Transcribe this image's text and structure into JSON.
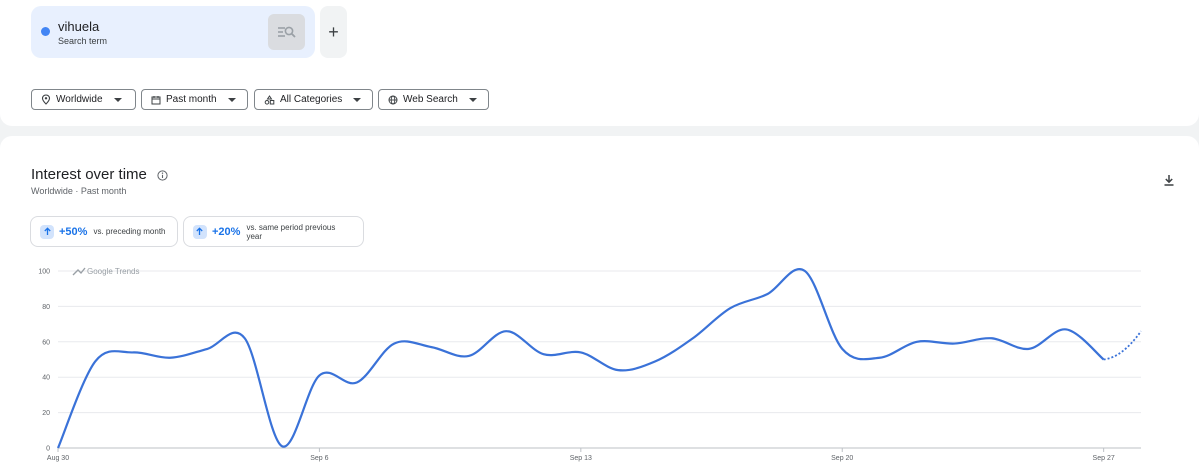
{
  "search_term": {
    "name": "vihuela",
    "subtitle": "Search term",
    "dot_color": "#4285f4",
    "compare_icon": "search-compare-icon",
    "add_icon": "plus-icon"
  },
  "filters": [
    {
      "label": "Worldwide",
      "icon": "location-pin-icon"
    },
    {
      "label": "Past month",
      "icon": "calendar-icon"
    },
    {
      "label": "All Categories",
      "icon": "categories-icon"
    },
    {
      "label": "Web Search",
      "icon": "globe-icon"
    }
  ],
  "section": {
    "title": "Interest over time",
    "subtitle": "Worldwide · Past month",
    "info_icon": "info-icon",
    "download_icon": "download-icon"
  },
  "stats": [
    {
      "value": "+50%",
      "text": "vs. preceding month"
    },
    {
      "value": "+20%",
      "text": "vs. same period previous year"
    }
  ],
  "chart_data": {
    "type": "line",
    "watermark": "Google Trends",
    "ylim": [
      0,
      100
    ],
    "yticks": [
      0,
      20,
      40,
      60,
      80,
      100
    ],
    "x_labels": [
      {
        "day": 0,
        "label": "Aug 30"
      },
      {
        "day": 7,
        "label": "Sep 6"
      },
      {
        "day": 14,
        "label": "Sep 13"
      },
      {
        "day": 21,
        "label": "Sep 20"
      },
      {
        "day": 28,
        "label": "Sep 27"
      }
    ],
    "x_range": [
      0,
      29
    ],
    "grid": true,
    "line_color": "#3a72d8",
    "series": [
      {
        "values": [
          0,
          49,
          54,
          51,
          56,
          62,
          1,
          41,
          37,
          59,
          57,
          52,
          66,
          53,
          54,
          44,
          49,
          62,
          79,
          87,
          100,
          56,
          51,
          60,
          59,
          62,
          56,
          67,
          50
        ],
        "partial_values": [
          50,
          66
        ]
      }
    ]
  }
}
